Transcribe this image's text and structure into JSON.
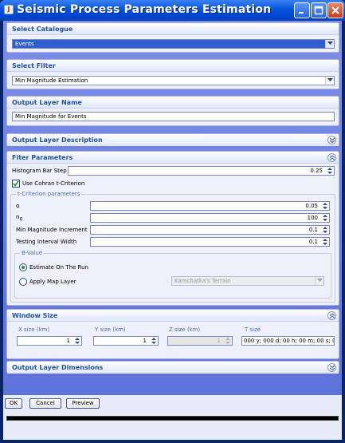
{
  "window": {
    "title": "Seismic Process Parameters Estimation"
  },
  "select_catalogue": {
    "header": "Select Catalogue",
    "value": "Events"
  },
  "select_filter": {
    "header": "Select Filter",
    "value": "Min Magnitude Estimation"
  },
  "output_layer_name": {
    "header": "Output Layer Name",
    "value": "Min Magnitude for Events"
  },
  "output_layer_description": {
    "header": "Output Layer Description"
  },
  "filter_parameters": {
    "header": "Fiter Parameters",
    "histogram_label": "Histogram Bar Step",
    "histogram_value": "0.25",
    "use_cohran_label": "Use Cohran t-Criterion",
    "use_cohran_checked": true,
    "t_criterion": {
      "title": "t-Criterion parameters",
      "alpha_label": "α",
      "alpha_value": "0.05",
      "n0_label_main": "n",
      "n0_label_sub": "0",
      "n0_value": "100",
      "min_mag_inc_label": "Min Magnitude Increment",
      "min_mag_inc_value": "0.1",
      "testing_interval_label": "Testing Interval Width",
      "testing_interval_value": "0.1",
      "b_value": {
        "title": "B-Value",
        "estimate_label": "Estimate On The Run",
        "apply_map_label": "Apply Map Layer",
        "map_layer_value": "Kamchatka's Terrain",
        "selected": "estimate"
      }
    }
  },
  "window_size": {
    "header": "Window Size",
    "x_label": "X size (km)",
    "x_value": "1",
    "y_label": "Y size (km)",
    "y_value": "1",
    "z_label": "Z size (km)",
    "z_value": "1",
    "t_label": "T size",
    "t_value": "000 y; 000 d; 00 h; 00 m; 00 s; 0"
  },
  "output_layer_dimensions": {
    "header": "Output Layer Dimensions"
  },
  "buttons": {
    "ok": "OK",
    "cancel": "Cancel",
    "preview": "Preview"
  },
  "colors": {
    "titlebar": "#0048d8",
    "panel_header_text": "#2050a8",
    "client_background": "#6b7ee0"
  }
}
